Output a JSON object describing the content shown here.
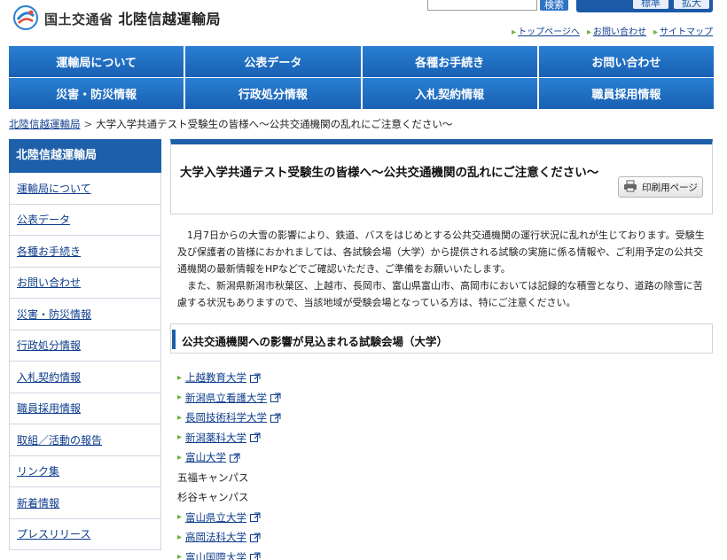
{
  "header": {
    "org_name": "国土交通省",
    "bureau_name": "北陸信越運輸局",
    "search_button": "検索",
    "util_buttons": [
      "標準",
      "拡大"
    ],
    "top_links": [
      "トップページへ",
      "お問い合わせ",
      "サイトマップ"
    ]
  },
  "gnav": {
    "items": [
      "運輸局について",
      "公表データ",
      "各種お手続き",
      "お問い合わせ",
      "災害・防災情報",
      "行政処分情報",
      "入札契約情報",
      "職員採用情報"
    ]
  },
  "breadcrumb": {
    "home": "北陸信越運輸局",
    "separator": ">",
    "current": "大学入学共通テスト受験生の皆様へ～公共交通機関の乱れにご注意ください～"
  },
  "sidebar": {
    "heading": "北陸信越運輸局",
    "items": [
      "運輸局について",
      "公表データ",
      "各種お手続き",
      "お問い合わせ",
      "災害・防災情報",
      "行政処分情報",
      "入札契約情報",
      "職員採用情報",
      "取組／活動の報告",
      "リンク集",
      "新着情報",
      "プレスリリース"
    ]
  },
  "main": {
    "title": "大学入学共通テスト受験生の皆様へ～公共交通機関の乱れにご注意ください～",
    "print_label": "印刷用ページ",
    "paragraph1": "1月7日からの大雪の影響により、鉄道、バスをはじめとする公共交通機関の運行状況に乱れが生じております。受験生及び保護者の皆様におかれましては、各試験会場（大学）から提供される試験の実施に係る情報や、ご利用予定の公共交通機関の最新情報をHPなどでご確認いただき、ご準備をお願いいたします。",
    "paragraph2": "また、新潟県新潟市秋葉区、上越市、長岡市、富山県富山市、高岡市においては記録的な積雪となり、道路の除雪に苦慮する状況もありますので、当該地域が受験会場となっている方は、特にご注意ください。",
    "section_heading": "公共交通機関への影響が見込まれる試験会場（大学）",
    "universities": [
      {
        "name": "上越教育大学",
        "link": true
      },
      {
        "name": "新潟県立看護大学",
        "link": true
      },
      {
        "name": "長岡技術科学大学",
        "link": true
      },
      {
        "name": "新潟薬科大学",
        "link": true
      },
      {
        "name": "富山大学",
        "link": true
      },
      {
        "name": "五福キャンパス",
        "link": false
      },
      {
        "name": "杉谷キャンパス",
        "link": false
      },
      {
        "name": "富山県立大学",
        "link": true
      },
      {
        "name": "高岡法科大学",
        "link": true
      },
      {
        "name": "富山国際大学",
        "link": true
      }
    ]
  },
  "colors": {
    "brand_blue": "#1d5fa9",
    "link": "#0d3c8c",
    "bullet_green": "#6bb13c"
  }
}
